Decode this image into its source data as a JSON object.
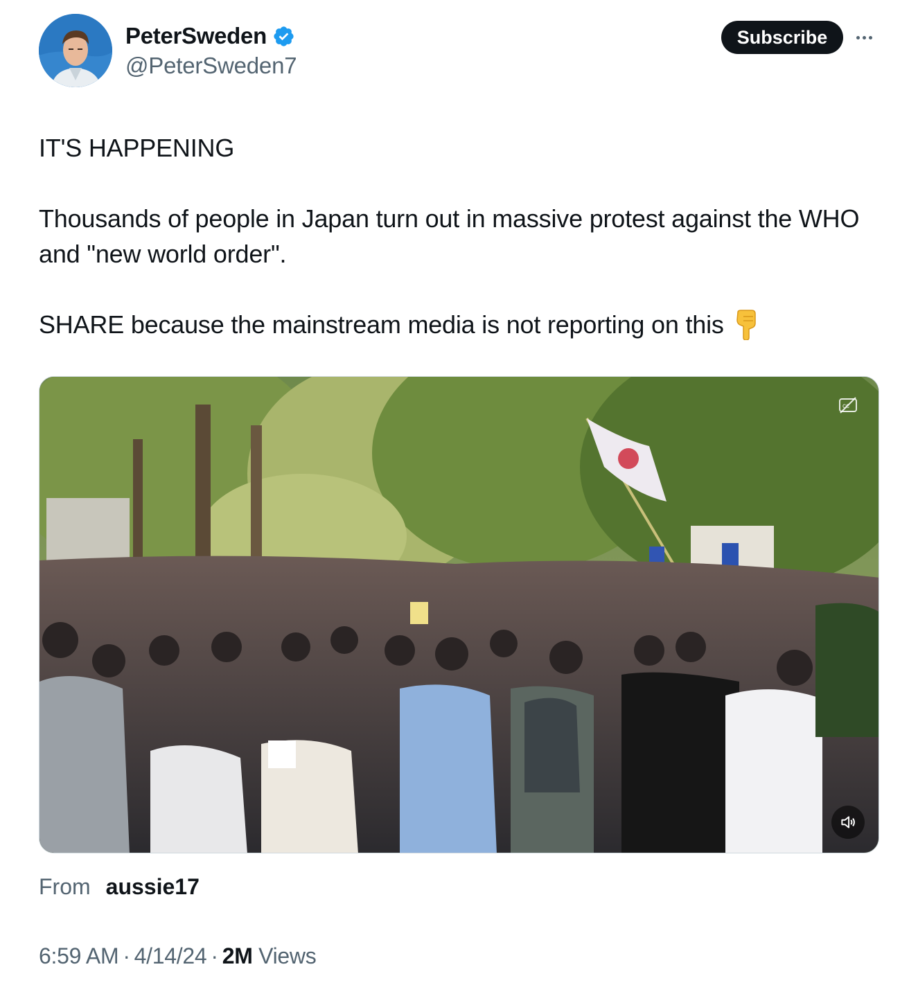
{
  "author": {
    "display_name": "PeterSweden",
    "handle": "@PeterSweden7",
    "verified": true,
    "verified_color": "#1d9bf0"
  },
  "header": {
    "subscribe_label": "Subscribe",
    "more_icon": "more-horizontal-icon"
  },
  "tweet": {
    "line1": "IT'S HAPPENING",
    "line2": "Thousands of people in Japan turn out in massive protest against the WHO and \"new world order\".",
    "line3": "SHARE because the mainstream media is not reporting on this",
    "emoji": "backhand-index-pointing-down-emoji"
  },
  "media": {
    "type": "video",
    "cc_icon": "closed-captions-off-icon",
    "volume_icon": "volume-muted-icon"
  },
  "source": {
    "from_label": "From",
    "from_name": "aussie17"
  },
  "meta": {
    "time": "6:59 AM",
    "sep1": "·",
    "date": "4/14/24",
    "sep2": "·",
    "views_count": "2M",
    "views_label": "Views"
  }
}
